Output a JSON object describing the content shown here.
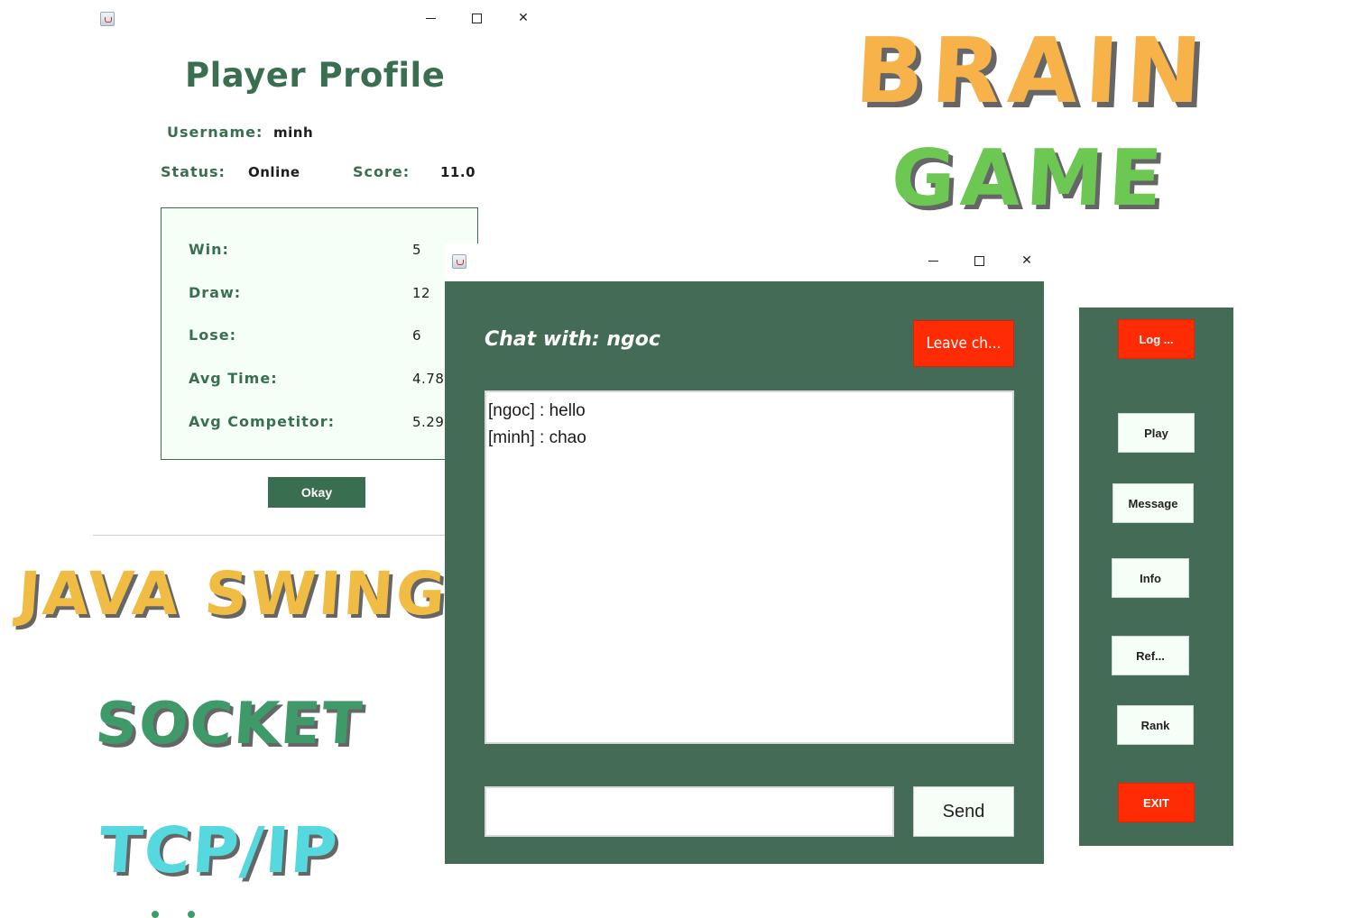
{
  "profile_window": {
    "title": "Player Profile",
    "username_label": "Username:",
    "username": "minh",
    "status_label": "Status:",
    "status": "Online",
    "score_label": "Score:",
    "score": "11.0",
    "stats": [
      {
        "label": "Win:",
        "value": "5"
      },
      {
        "label": "Draw:",
        "value": "12"
      },
      {
        "label": "Lose:",
        "value": "6"
      },
      {
        "label": "Avg Time:",
        "value": "4.78"
      },
      {
        "label": "Avg Competitor:",
        "value": "5.29"
      }
    ],
    "okay_label": "Okay"
  },
  "decor": {
    "brain": "BRAIN",
    "game": "GAME",
    "java_swing": "JAVA SWING",
    "socket": "SOCKET",
    "tcp_ip": "TCP/IP"
  },
  "chat_window": {
    "title": "Chat with: ngoc",
    "leave_label": "Leave ch...",
    "messages": [
      "[ngoc] : hello",
      "[minh] : chao"
    ],
    "input_value": "",
    "send_label": "Send"
  },
  "side_panel": {
    "logout_label": "Log ...",
    "play_label": "Play",
    "message_label": "Message",
    "info_label": "Info",
    "refresh_label": "Ref...",
    "rank_label": "Rank",
    "exit_label": "EXIT"
  },
  "colors": {
    "panel_green": "#436b55",
    "title_green": "#3a6e51",
    "danger_red": "#ff2b05",
    "brain_orange": "#f7b24a",
    "game_green": "#6cc853",
    "socket_green": "#3f9a6a",
    "tcp_cyan": "#55d9df"
  }
}
